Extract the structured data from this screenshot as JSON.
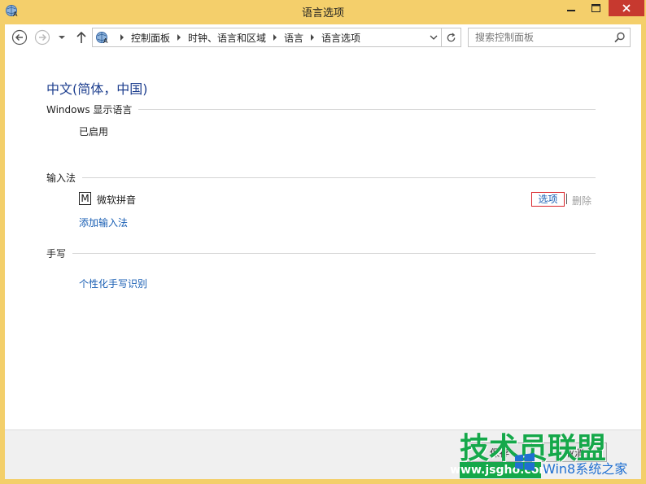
{
  "window": {
    "title": "语言选项",
    "minimize_glyph": "—",
    "maximize_glyph": "□",
    "close_glyph": "✕"
  },
  "nav": {
    "breadcrumbs": [
      "控制面板",
      "时钟、语言和区域",
      "语言",
      "语言选项"
    ],
    "search_placeholder": "搜索控制面板"
  },
  "main": {
    "language_title": "中文(简体，中国)",
    "display_section": {
      "heading": "Windows 显示语言",
      "status": "已启用"
    },
    "ime_section": {
      "heading": "输入法",
      "ime_icon_letter": "M",
      "ime_name": "微软拼音",
      "options_label": "选项",
      "remove_label": "删除",
      "add_label": "添加输入法"
    },
    "handwriting_section": {
      "heading": "手写",
      "personalize_label": "个性化手写识别"
    }
  },
  "footer": {
    "save_label": "保存",
    "cancel_label": "取消"
  },
  "watermark": {
    "brand": "技术员联盟",
    "url": "www.jsgho.com",
    "site_name": "Win8系统之家"
  },
  "colors": {
    "titlebar": "#f4cf6b",
    "link": "#1a5fb4",
    "heading": "#1e3f8f",
    "close_button": "#c7392f",
    "highlight_border": "#d9262c",
    "watermark_green": "#15a84a"
  }
}
